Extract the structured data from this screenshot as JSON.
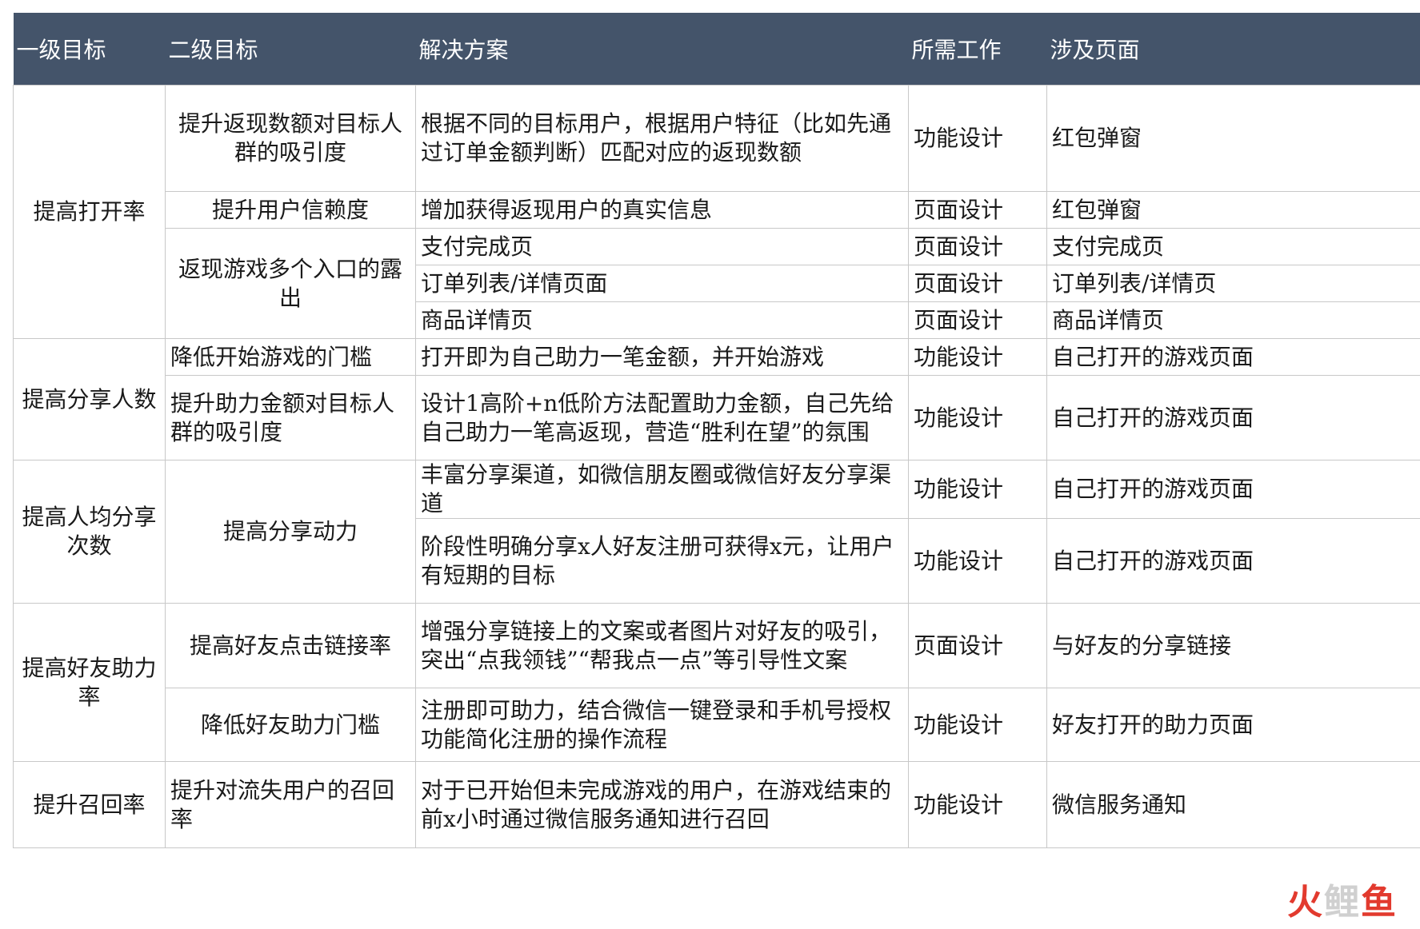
{
  "table": {
    "headers": [
      "一级目标",
      "二级目标",
      "解决方案",
      "所需工作",
      "涉及页面"
    ],
    "primary_goals": [
      "提高打开率",
      "提高分享人数",
      "提高人均分享次数",
      "提高好友助力率",
      "提升召回率"
    ],
    "secondary_goals": [
      "提升返现数额对目标人群的吸引度",
      "提升用户信赖度",
      "返现游戏多个入口的露出",
      "降低开始游戏的门槛",
      "提升助力金额对目标人群的吸引度",
      "提高分享动力",
      "提高好友点击链接率",
      "降低好友助力门槛",
      "提升对流失用户的召回率"
    ],
    "rows": [
      {
        "solution": "根据不同的目标用户，根据用户特征（比如先通过订单金额判断）匹配对应的返现数额",
        "work": "功能设计",
        "page": "红包弹窗"
      },
      {
        "solution": "增加获得返现用户的真实信息",
        "work": "页面设计",
        "page": "红包弹窗"
      },
      {
        "solution": "支付完成页",
        "work": "页面设计",
        "page": "支付完成页"
      },
      {
        "solution": "订单列表/详情页面",
        "work": "页面设计",
        "page": "订单列表/详情页"
      },
      {
        "solution": "商品详情页",
        "work": "页面设计",
        "page": "商品详情页"
      },
      {
        "solution": "打开即为自己助力一笔金额，并开始游戏",
        "work": "功能设计",
        "page": "自己打开的游戏页面"
      },
      {
        "solution": "设计1高阶+n低阶方法配置助力金额，自己先给自己助力一笔高返现，营造“胜利在望”的氛围",
        "work": "功能设计",
        "page": "自己打开的游戏页面"
      },
      {
        "solution": "丰富分享渠道，如微信朋友圈或微信好友分享渠道",
        "work": "功能设计",
        "page": "自己打开的游戏页面"
      },
      {
        "solution": "阶段性明确分享x人好友注册可获得x元，让用户有短期的目标",
        "work": "功能设计",
        "page": "自己打开的游戏页面"
      },
      {
        "solution": "增强分享链接上的文案或者图片对好友的吸引，突出“点我领钱”“帮我点一点”等引导性文案",
        "work": "页面设计",
        "page": "与好友的分享链接"
      },
      {
        "solution": "注册即可助力，结合微信一键登录和手机号授权功能简化注册的操作流程",
        "work": "功能设计",
        "page": "好友打开的助力页面"
      },
      {
        "solution": "对于已开始但未完成游戏的用户，在游戏结束的前x小时通过微信服务通知进行召回",
        "work": "功能设计",
        "page": "微信服务通知"
      }
    ]
  },
  "watermark": {
    "part1": "火",
    "part2": "鲤",
    "part3": "鱼"
  }
}
